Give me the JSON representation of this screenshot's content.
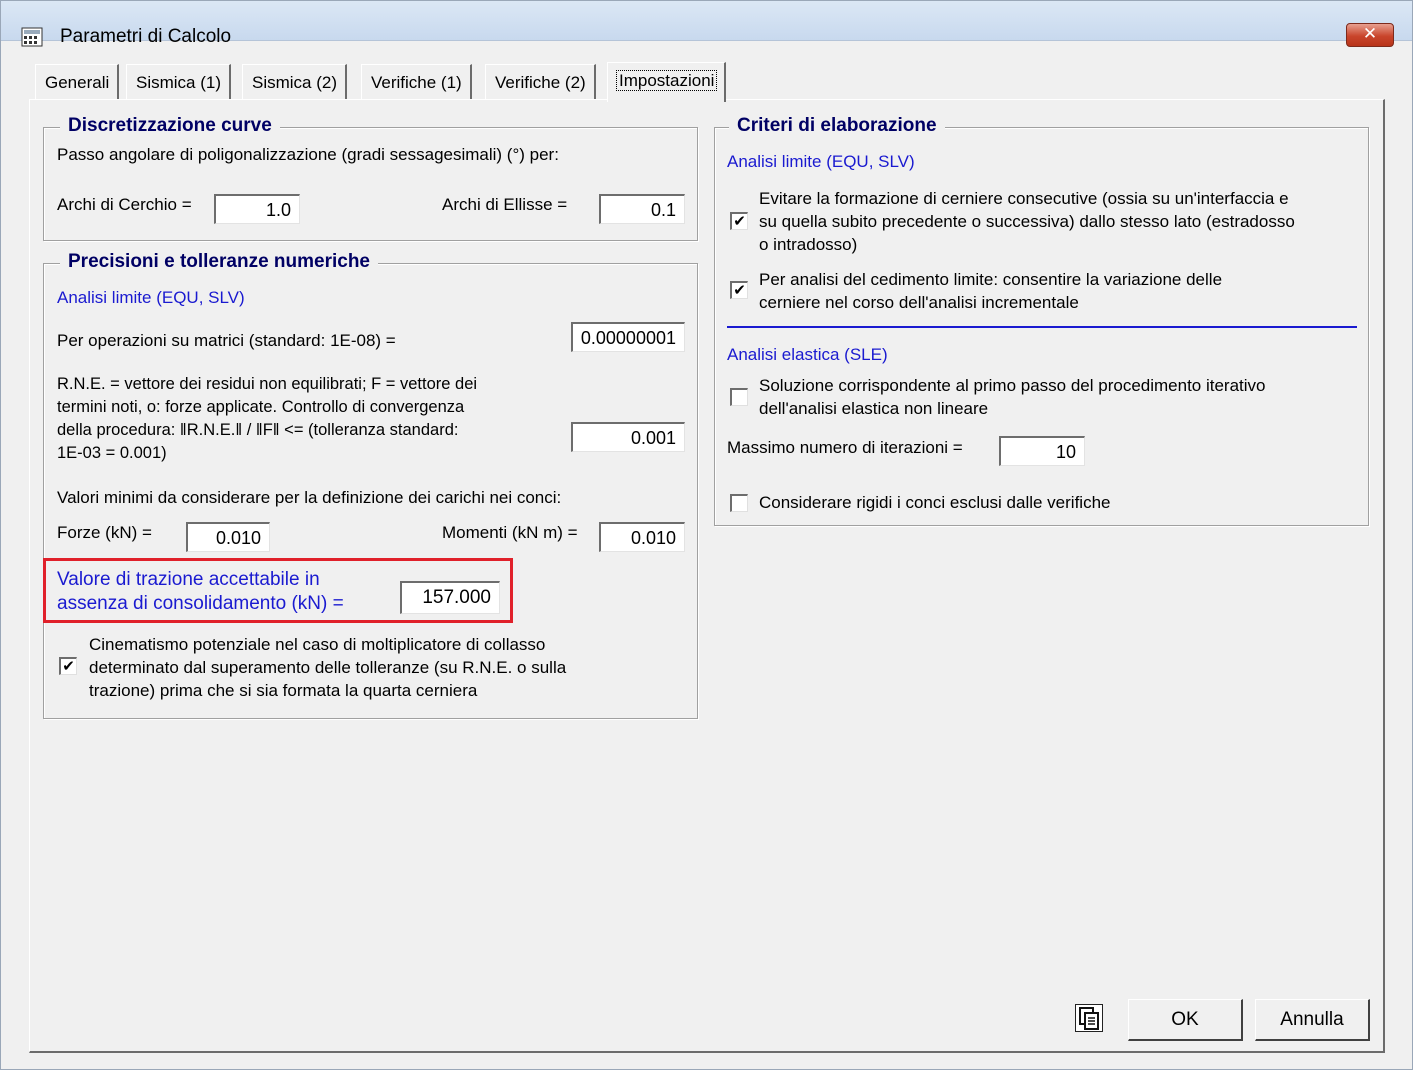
{
  "window": {
    "title": "Parametri di Calcolo",
    "close_label": "✕"
  },
  "tabs": [
    {
      "label": "Generali"
    },
    {
      "label": "Sismica (1)"
    },
    {
      "label": "Sismica (2)"
    },
    {
      "label": "Verifiche (1)"
    },
    {
      "label": "Verifiche (2)"
    },
    {
      "label": "Impostazioni",
      "active": true
    }
  ],
  "discretizzazione": {
    "title": "Discretizzazione curve",
    "description": "Passo angolare di poligonalizzazione (gradi sessagesimali) (°) per:",
    "archi_cerchio_label": "Archi di Cerchio =",
    "archi_cerchio_value": "1.0",
    "archi_ellisse_label": "Archi di Ellisse =",
    "archi_ellisse_value": "0.1"
  },
  "precisioni": {
    "title": "Precisioni e tolleranze numeriche",
    "subheading": "Analisi limite (EQU, SLV)",
    "matrici_label": "Per operazioni su matrici (standard: 1E-08) =",
    "matrici_value": "0.00000001",
    "rne_lines": [
      "R.N.E. = vettore dei residui non equilibrati; F = vettore dei",
      "termini noti, o: forze applicate. Controllo di convergenza",
      "della procedura: ‖R.N.E.‖  /  ‖F‖   <=  (tolleranza standard:",
      "1E-03 = 0.001)"
    ],
    "rne_value": "0.001",
    "valori_minimi_label": "Valori minimi da considerare per la definizione dei carichi nei conci:",
    "forze_label": "Forze (kN) =",
    "forze_value": "0.010",
    "momenti_label": "Momenti (kN m) =",
    "momenti_value": "0.010",
    "trazione_lines": [
      "Valore di trazione accettabile in",
      "assenza di consolidamento (kN) ="
    ],
    "trazione_value": "157.000",
    "cinematismo_checked": true,
    "cinematismo_lines": [
      "Cinematismo potenziale nel caso di moltiplicatore di collasso",
      "determinato dal superamento delle tolleranze (su R.N.E. o sulla",
      "trazione) prima che si sia formata la quarta cerniera"
    ]
  },
  "criteri": {
    "title": "Criteri di elaborazione",
    "limite_heading": "Analisi limite (EQU, SLV)",
    "evitare_checked": true,
    "evitare_lines": [
      "Evitare la formazione di cerniere consecutive (ossia su un'interfaccia e",
      "su quella subito precedente o successiva) dallo stesso lato (estradosso",
      "o intradosso)"
    ],
    "cedimento_checked": true,
    "cedimento_lines": [
      "Per analisi del cedimento limite: consentire la variazione delle",
      "cerniere nel corso dell'analisi incrementale"
    ],
    "elastica_heading": "Analisi elastica (SLE)",
    "soluzione_checked": false,
    "soluzione_lines": [
      "Soluzione corrispondente al primo passo del procedimento iterativo",
      "dell'analisi elastica non lineare"
    ],
    "iterazioni_label": "Massimo numero di iterazioni =",
    "iterazioni_value": "10",
    "rigidi_checked": false,
    "rigidi_label": "Considerare rigidi i conci esclusi dalle verifiche"
  },
  "buttons": {
    "ok": "OK",
    "annulla": "Annulla"
  },
  "check_glyph": "✔"
}
